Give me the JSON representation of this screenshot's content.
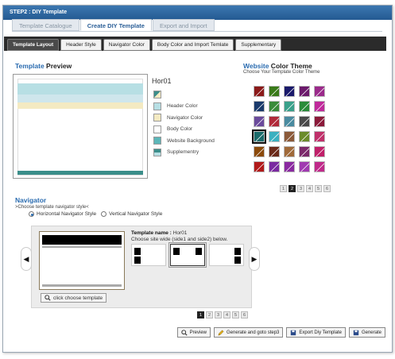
{
  "window": {
    "title": "STEP2 : DIY Template"
  },
  "topnav": [
    "Template Catalogue",
    "Create DIY Template",
    "Export and Import"
  ],
  "subtabs": [
    "Template Layout",
    "Header Style",
    "Navigator Color",
    "Body Color and Import Temlate",
    "Supplementary"
  ],
  "preview": {
    "heading_a": "Template",
    "heading_b": " Preview",
    "template_name": "Hor01"
  },
  "legend": [
    {
      "label": "Header Color",
      "color": "#b7dfe4"
    },
    {
      "label": "Navigator Color",
      "color": "#f4eac2"
    },
    {
      "label": "Body Color",
      "color": "#ffffff"
    },
    {
      "label": "Website Background",
      "color": "#5cb6b8"
    },
    {
      "label": "Supplementry",
      "color": "#3b8e8a"
    }
  ],
  "color_theme": {
    "heading_a": "Website",
    "heading_b": " Color Theme",
    "subtitle": "Choose Your Template Color Theme",
    "swatches": [
      "#8b1a1a",
      "#3a7a1a",
      "#1a1a6b",
      "#6b1a6b",
      "#9b2a8b",
      "#1a3a6b",
      "#3a8b3a",
      "#3aa08a",
      "#2a8b3a",
      "#c02a9b",
      "#6a4a9b",
      "#b02a3a",
      "#4a8ba0",
      "#4a4a4a",
      "#8b1a3a",
      "#1a6b6b",
      "#3ab0c0",
      "#8b5a3a",
      "#6a8b2a",
      "#c0306a",
      "#8b4a0a",
      "#6a2a1a",
      "#a06a3a",
      "#7a2a6a",
      "#c0206a",
      "#b01a1a",
      "#7a2aa0",
      "#8a2aa0",
      "#a03ab0",
      "#c02a8a"
    ],
    "selected_index": 15,
    "pages": [
      "1",
      "2",
      "3",
      "4",
      "5",
      "6"
    ],
    "current_page": "2"
  },
  "navigator": {
    "heading": "Navigator",
    "prompt": ">Choose template navigator style<",
    "options": [
      "Horizontal Navigator Style",
      "Vertical Navigator Style"
    ],
    "selected": "Horizontal Navigator Style",
    "template_name_label": "Template name :",
    "template_name": "Hor01",
    "site_wide_text": "Choose site wide (side1 and side2) below.",
    "choose_button": "click choose template",
    "pages": [
      "1",
      "2",
      "3",
      "4",
      "5",
      "6"
    ],
    "current_page": "1"
  },
  "actions": [
    "Preview",
    "Generate and goto step3",
    "Export Diy Template",
    "Generate"
  ]
}
